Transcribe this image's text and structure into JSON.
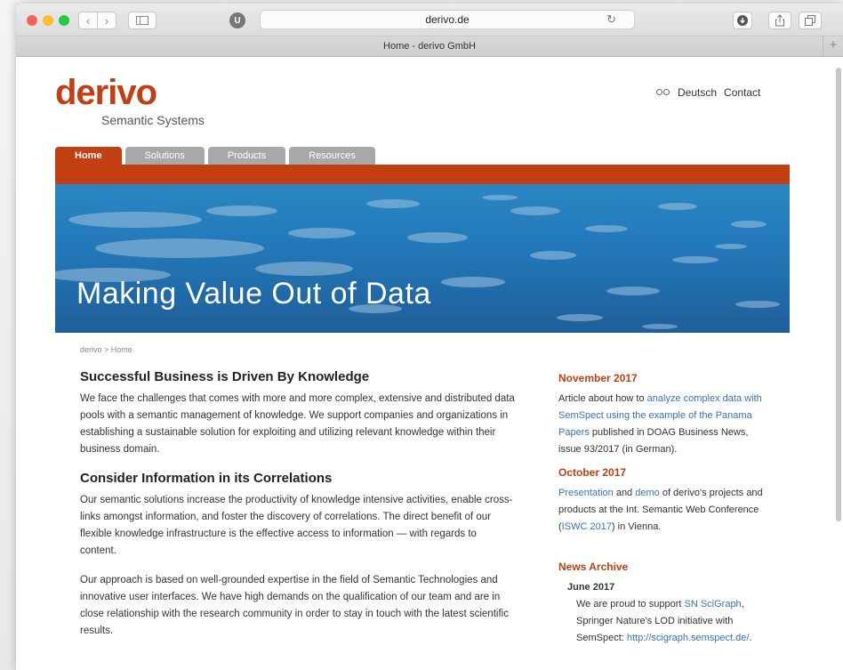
{
  "browser": {
    "url": "derivo.de",
    "tab_title": "Home - derivo GmbH",
    "new_tab": "+",
    "reload_icon": "↻",
    "colors": {
      "close": "#ff5f57",
      "minimize": "#ffbd2e",
      "zoom": "#28c940"
    }
  },
  "site": {
    "logo": "derivo",
    "logo_sub": "Semantic Systems",
    "lang": "Deutsch",
    "contact": "Contact",
    "brand_color": "#c23f12",
    "tabs": [
      "Home",
      "Solutions",
      "Products",
      "Resources"
    ],
    "hero_title": "Making Value Out of Data",
    "breadcrumb": "derivo > Home"
  },
  "main": {
    "h1": "Successful Business is Driven By Knowledge",
    "p1": "We face the challenges that comes with more and more complex, extensive and distributed data pools with a semantic management of knowledge. We support companies and organizations in establishing a sustainable solution for exploiting and utilizing relevant knowledge within their business domain.",
    "h2": "Consider Information in its Correlations",
    "p2": "Our semantic solutions increase the productivity of knowledge intensive activities, enable cross-links amongst information, and foster the discovery of correlations. The direct benefit of our flexible knowledge infrastructure is the effective access to information — with regards to content.",
    "p3": "Our approach is based on well-grounded expertise in the field of Semantic Technologies and innovative user interfaces. We have high demands on the qualification of our team and are in close relationship with the research community in order to stay in touch with the latest scientific results."
  },
  "news": {
    "n1_date": "November 2017",
    "n1_pre": "Article about how to ",
    "n1_link": "analyze complex data with SemSpect using the example of the Panama Papers",
    "n1_post": " published in DOAG Business News, issue 93/2017 (in German).",
    "n2_date": "October 2017",
    "n2_link1": "Presentation",
    "n2_and": " and ",
    "n2_link2": "demo",
    "n2_mid": " of derivo's projects and products at the Int. Semantic Web Conference (",
    "n2_link3": "ISWC 2017",
    "n2_post": ") in Vienna.",
    "archive_title": "News Archive",
    "archive_date": "June 2017",
    "a_pre": "We are proud to support ",
    "a_link1": "SN SciGraph",
    "a_mid": ", Springer Nature's LOD initiative with SemSpect: ",
    "a_link2": "http://scigraph.semspect.de/",
    "a_post": "."
  }
}
